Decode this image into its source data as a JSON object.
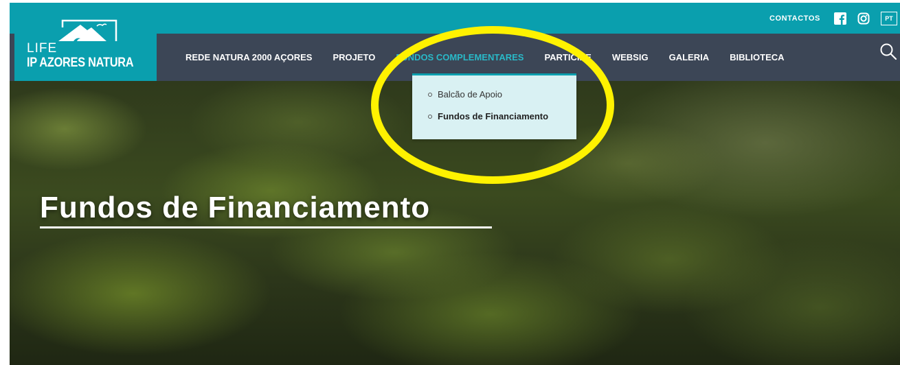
{
  "header": {
    "logo": {
      "life": "LIFE",
      "name": "IP AZORES NATURA"
    },
    "top_links": {
      "contact": "CONTACTOS",
      "language": "PT"
    },
    "icons": [
      "facebook-icon",
      "instagram-icon",
      "search-icon"
    ]
  },
  "nav": {
    "items": [
      {
        "label": "REDE NATURA 2000 AÇORES"
      },
      {
        "label": "PROJETO"
      },
      {
        "label": "FUNDOS COMPLEMENTARES"
      },
      {
        "label": "PARTICIPE"
      },
      {
        "label": "WEBSIG"
      },
      {
        "label": "GALERIA"
      },
      {
        "label": "BIBLIOTECA"
      }
    ],
    "active_index": 2
  },
  "dropdown": {
    "items": [
      {
        "label": "Balcão de Apoio"
      },
      {
        "label": "Fundos de Financiamento"
      }
    ],
    "active_index": 1
  },
  "hero": {
    "title": "Fundos de Financiamento"
  },
  "colors": {
    "teal": "#0a9fae",
    "nav_bg": "#3c4656",
    "active": "#29b9c8",
    "dropdown_bg": "#d9f1f3",
    "highlight": "#fff200"
  }
}
